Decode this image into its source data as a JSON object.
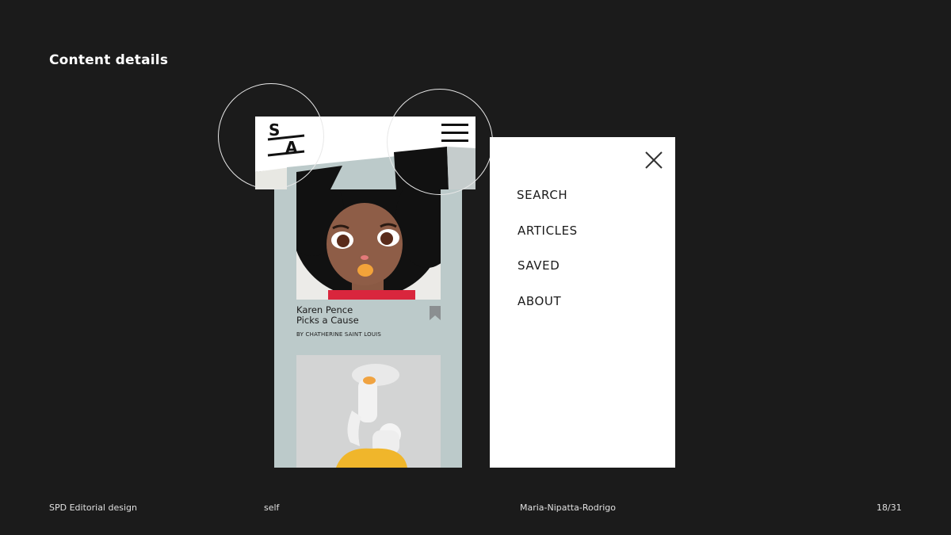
{
  "slide": {
    "title": "Content details"
  },
  "app": {
    "logo_text": "SA",
    "menu_icon": "hamburger-icon",
    "card": {
      "title_line1": "Karen Pence",
      "title_line2": "Picks a Cause",
      "byline": "BY CHATHERINE SAINT LOUIS",
      "bookmark_icon": "bookmark-icon"
    }
  },
  "menu": {
    "close_icon": "close-icon",
    "items": [
      {
        "label": "SEARCH"
      },
      {
        "label": "ARTICLES"
      },
      {
        "label": "SAVED"
      },
      {
        "label": "ABOUT"
      }
    ]
  },
  "footer": {
    "project": "SPD Editorial design",
    "type": "self",
    "author": "Maria-Nipatta-Rodrigo",
    "page": "18/31"
  },
  "colors": {
    "background": "#1b1b1b",
    "phone_bg": "#bccaca",
    "panel_bg": "#ffffff",
    "accent_orange": "#f2a33a",
    "accent_yellow": "#f0b62b"
  }
}
